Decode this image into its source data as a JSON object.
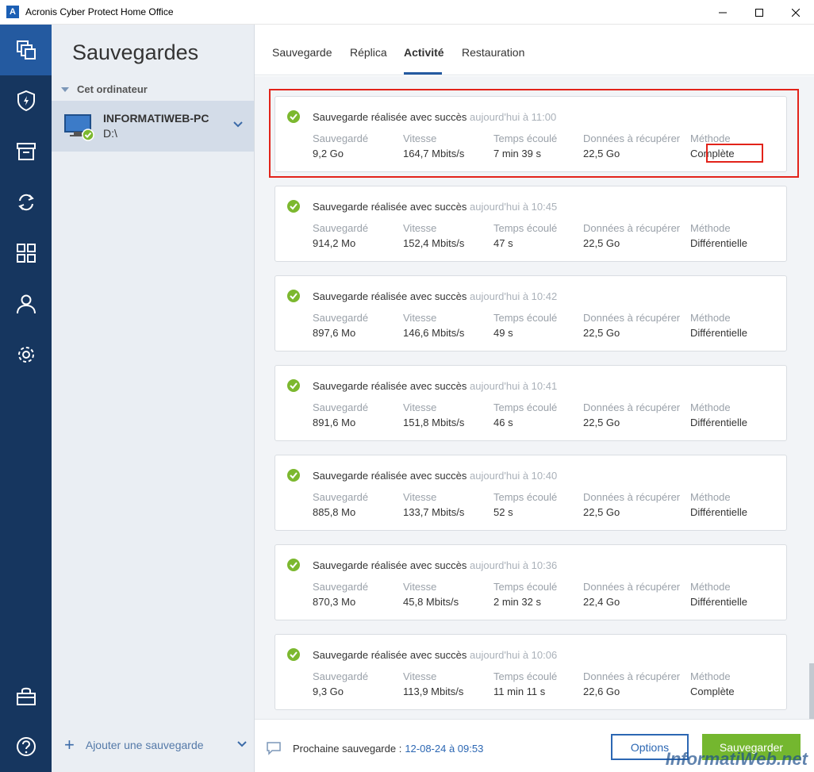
{
  "window": {
    "title": "Acronis Cyber Protect Home Office",
    "logo": "A"
  },
  "nav": {
    "icons": [
      "backup-icon",
      "shield-icon",
      "archive-icon",
      "sync-icon",
      "dashboard-icon",
      "account-icon",
      "settings-icon"
    ],
    "bottom_icons": [
      "shop-icon",
      "help-icon"
    ]
  },
  "sidebar": {
    "title": "Sauvegardes",
    "section": "Cet ordinateur",
    "item": {
      "name": "INFORMATIWEB-PC",
      "drive": "D:\\"
    },
    "add_label": "Ajouter une sauvegarde"
  },
  "tabs": [
    "Sauvegarde",
    "Réplica",
    "Activité",
    "Restauration"
  ],
  "active_tab": "Activité",
  "labels": {
    "saved": "Sauvegardé",
    "speed": "Vitesse",
    "elapsed": "Temps écoulé",
    "recover": "Données à récupérer",
    "method": "Méthode"
  },
  "activities": [
    {
      "status": "Sauvegarde réalisée avec succès",
      "time": "aujourd'hui à 11:00",
      "saved": "9,2 Go",
      "speed": "164,7 Mbits/s",
      "elapsed": "7 min 39 s",
      "recover": "22,5 Go",
      "method": "Complète"
    },
    {
      "status": "Sauvegarde réalisée avec succès",
      "time": "aujourd'hui à 10:45",
      "saved": "914,2 Mo",
      "speed": "152,4 Mbits/s",
      "elapsed": "47 s",
      "recover": "22,5 Go",
      "method": "Différentielle"
    },
    {
      "status": "Sauvegarde réalisée avec succès",
      "time": "aujourd'hui à 10:42",
      "saved": "897,6 Mo",
      "speed": "146,6 Mbits/s",
      "elapsed": "49 s",
      "recover": "22,5 Go",
      "method": "Différentielle"
    },
    {
      "status": "Sauvegarde réalisée avec succès",
      "time": "aujourd'hui à 10:41",
      "saved": "891,6 Mo",
      "speed": "151,8 Mbits/s",
      "elapsed": "46 s",
      "recover": "22,5 Go",
      "method": "Différentielle"
    },
    {
      "status": "Sauvegarde réalisée avec succès",
      "time": "aujourd'hui à 10:40",
      "saved": "885,8 Mo",
      "speed": "133,7 Mbits/s",
      "elapsed": "52 s",
      "recover": "22,5 Go",
      "method": "Différentielle"
    },
    {
      "status": "Sauvegarde réalisée avec succès",
      "time": "aujourd'hui à 10:36",
      "saved": "870,3 Mo",
      "speed": "45,8 Mbits/s",
      "elapsed": "2 min 32 s",
      "recover": "22,4 Go",
      "method": "Différentielle"
    },
    {
      "status": "Sauvegarde réalisée avec succès",
      "time": "aujourd'hui à 10:06",
      "saved": "9,3 Go",
      "speed": "113,9 Mbits/s",
      "elapsed": "11 min 11 s",
      "recover": "22,6 Go",
      "method": "Complète"
    }
  ],
  "footer": {
    "next_label": "Prochaine sauvegarde :",
    "next_date": "12-08-24 à 09:53",
    "options": "Options",
    "save": "Sauvegarder"
  },
  "watermark": "InformatiWeb.net",
  "colors": {
    "nav_bg": "#16365f",
    "accent": "#2c67b3",
    "success": "#7cb82f",
    "highlight": "#e2231a"
  }
}
